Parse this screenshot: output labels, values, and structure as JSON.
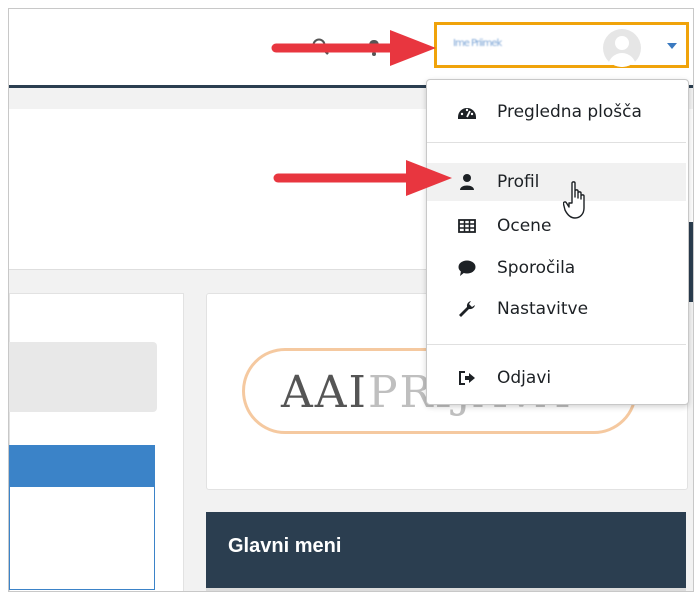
{
  "header": {
    "user_name": "Ime Priimek"
  },
  "user_menu": {
    "items": [
      {
        "label": "Pregledna plošča",
        "icon": "dashboard-icon"
      },
      {
        "label": "Profil",
        "icon": "user-icon"
      },
      {
        "label": "Ocene",
        "icon": "table-icon"
      },
      {
        "label": "Sporočila",
        "icon": "speech-bubble-icon"
      },
      {
        "label": "Nastavitve",
        "icon": "wrench-icon"
      },
      {
        "label": "Odjavi",
        "icon": "sign-out-icon"
      }
    ]
  },
  "login_logo": {
    "part1": "AAI",
    "part2": "PRIJAVA"
  },
  "main_menu": {
    "title": "Glavni meni"
  },
  "colors": {
    "navy": "#2b3e50",
    "highlight": "#f0a30a",
    "arrow": "#e8363f",
    "link_blue": "#3b83c8"
  }
}
